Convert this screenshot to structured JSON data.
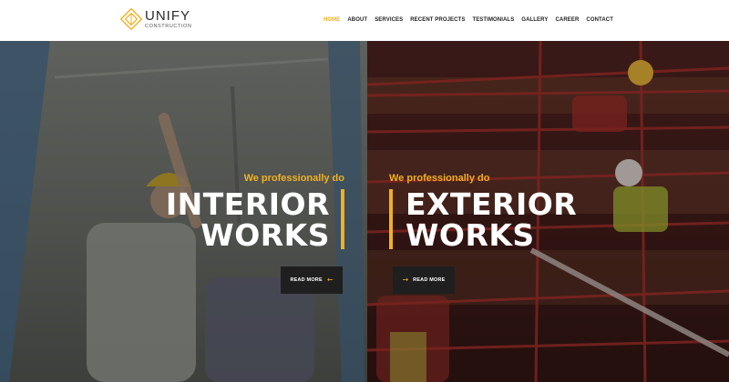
{
  "brand": {
    "name": "UNIFY",
    "subtitle": "CONSTRUCTION"
  },
  "nav": {
    "items": [
      {
        "label": "HOME",
        "active": true
      },
      {
        "label": "ABOUT",
        "active": false
      },
      {
        "label": "SERVICES",
        "active": false
      },
      {
        "label": "RECENT PROJECTS",
        "active": false
      },
      {
        "label": "TESTIMONIALS",
        "active": false
      },
      {
        "label": "GALLERY",
        "active": false
      },
      {
        "label": "CAREER",
        "active": false
      },
      {
        "label": "CONTACT",
        "active": false
      }
    ]
  },
  "hero": {
    "left": {
      "eyebrow": "We professionally do",
      "title_line1": "INTERIOR",
      "title_line2": "WORKS",
      "button_label": "READ MORE",
      "button_icon": "arrow-left-icon"
    },
    "right": {
      "eyebrow": "We professionally do",
      "title_line1": "EXTERIOR",
      "title_line2": "WORKS",
      "button_label": "READ MORE",
      "button_icon": "arrow-right-icon"
    }
  },
  "colors": {
    "accent": "#f2b01e",
    "button_bg": "#1f1f1f",
    "header_bg": "#ffffff",
    "text_dark": "#222222"
  }
}
